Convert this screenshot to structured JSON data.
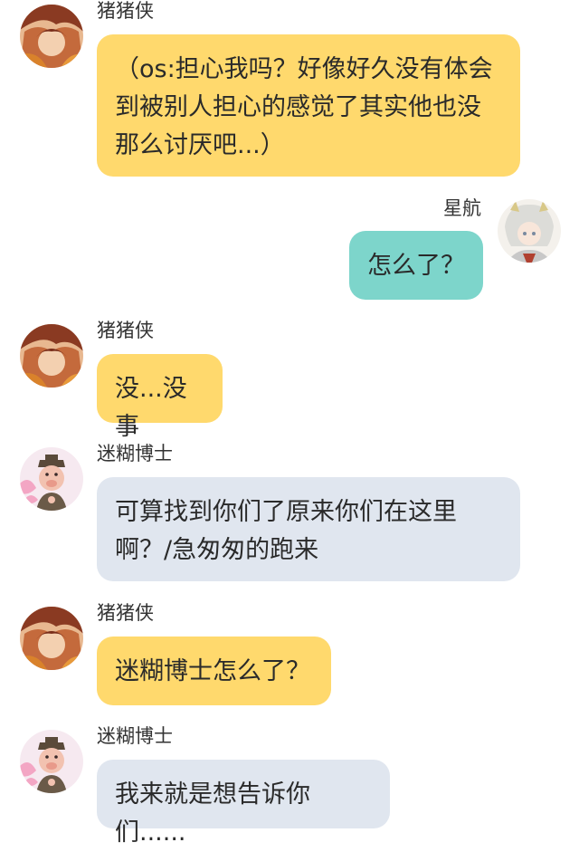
{
  "colors": {
    "left_bubble_zhuzhuxia": "#ffd96d",
    "right_bubble": "#7dd5cb",
    "left_bubble_mihu": "#e0e6ef",
    "background": "#ffffff"
  },
  "messages": [
    {
      "sender": "猪猪侠",
      "side": "left",
      "avatar": "zhuzhuxia-avatar",
      "text": "（os:担心我吗？好像好久没有体会到被别人担心的感觉了其实他也没那么讨厌吧...）"
    },
    {
      "sender": "星航",
      "side": "right",
      "avatar": "xinghang-avatar",
      "text": "怎么了？"
    },
    {
      "sender": "猪猪侠",
      "side": "left",
      "avatar": "zhuzhuxia-avatar",
      "text": "没...没事"
    },
    {
      "sender": "迷糊博士",
      "side": "left",
      "avatar": "mihu-avatar",
      "text": "可算找到你们了原来你们在这里啊？/急匆匆的跑来"
    },
    {
      "sender": "猪猪侠",
      "side": "left",
      "avatar": "zhuzhuxia-avatar",
      "text": "迷糊博士怎么了？"
    },
    {
      "sender": "迷糊博士",
      "side": "left",
      "avatar": "mihu-avatar",
      "text": "我来就是想告诉你们......"
    }
  ]
}
